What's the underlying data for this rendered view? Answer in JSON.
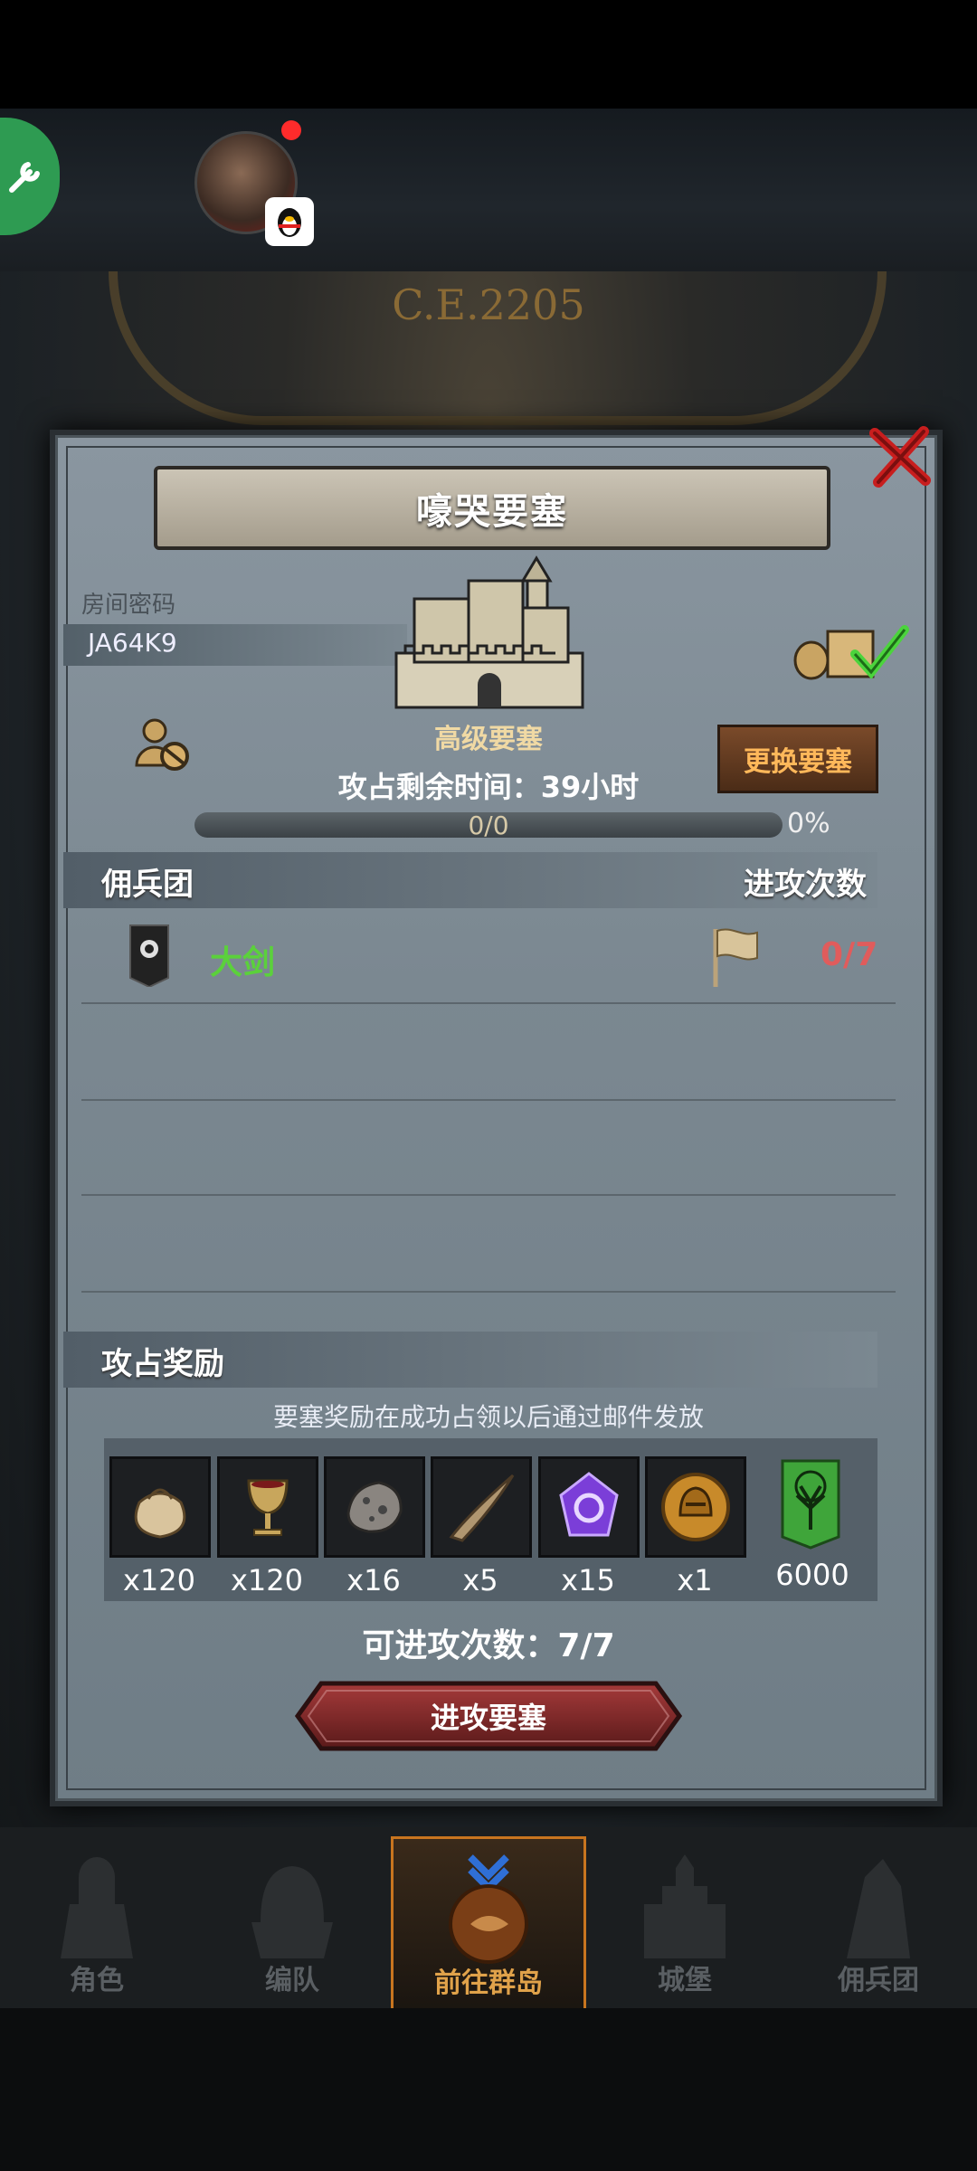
{
  "game": {
    "year": "C.E.2205",
    "dialog": {
      "title": "嚎哭要塞",
      "password_label": "房间密码",
      "password": "JA64K9",
      "fortress_grade": "高级要塞",
      "remaining_time": "攻占剩余时间：39小时",
      "change_button": "更换要塞",
      "progress_text": "0/0",
      "progress_percent": "0%",
      "progress_fraction": 0,
      "mercenary_header": "佣兵团",
      "attack_count_header": "进攻次数",
      "mercenary_row": {
        "name": "大剑",
        "attacks": "0/7"
      },
      "reward_header": "攻占奖励",
      "reward_note": "要塞奖励在成功占领以后通过邮件发放",
      "rewards": [
        {
          "icon": "sack-icon",
          "qty": "x120"
        },
        {
          "icon": "goblet-icon",
          "qty": "x120"
        },
        {
          "icon": "ore-icon",
          "qty": "x16"
        },
        {
          "icon": "horn-icon",
          "qty": "x5"
        },
        {
          "icon": "purple-crystal-icon",
          "qty": "x15"
        },
        {
          "icon": "helmet-coin-icon",
          "qty": "x1"
        },
        {
          "icon": "tree-banner-icon",
          "qty": "6000"
        }
      ],
      "attacks_left": "可进攻次数：7/7",
      "attack_button": "进攻要塞"
    },
    "nav": [
      {
        "label": "角色"
      },
      {
        "label": "编队"
      },
      {
        "label": "前往群岛"
      },
      {
        "label": "城堡"
      },
      {
        "label": "佣兵团"
      }
    ]
  }
}
